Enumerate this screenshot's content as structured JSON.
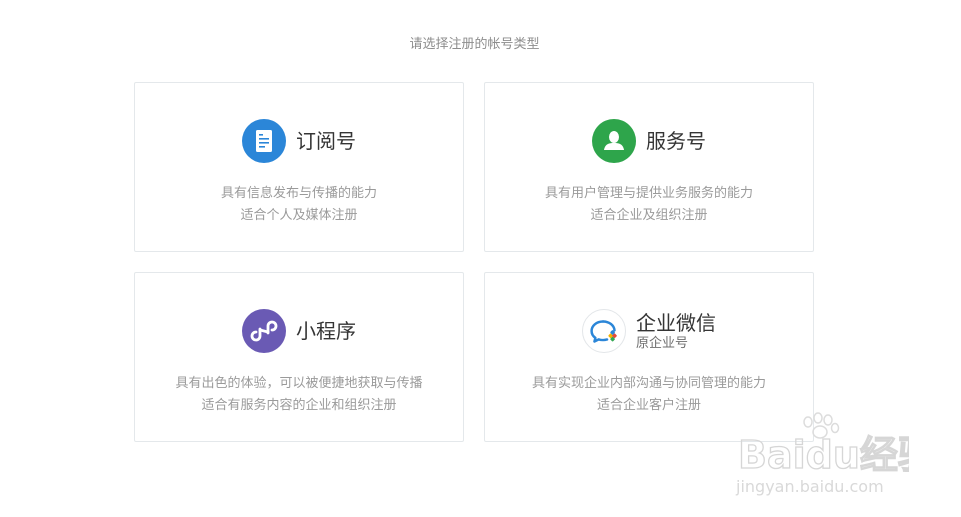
{
  "prompt": "请选择注册的帐号类型",
  "cards": [
    {
      "title": "订阅号",
      "icon": "document-icon",
      "color": "#2b86d8",
      "desc": [
        "具有信息发布与传播的能力",
        "适合个人及媒体注册"
      ]
    },
    {
      "title": "服务号",
      "icon": "person-icon",
      "color": "#2ea54b",
      "desc": [
        "具有用户管理与提供业务服务的能力",
        "适合企业及组织注册"
      ]
    },
    {
      "title": "小程序",
      "icon": "mini-program-icon",
      "color": "#6a5ab4",
      "desc": [
        "具有出色的体验，可以被便捷地获取与传播",
        "适合有服务内容的企业和组织注册"
      ]
    },
    {
      "title": "企业微信",
      "subtitle": "原企业号",
      "icon": "chat-bubble-icon",
      "color": "#2b86d8",
      "desc": [
        "具有实现企业内部沟通与协同管理的能力",
        "适合企业客户注册"
      ]
    }
  ],
  "watermark": {
    "logo_text": "Baidu经验",
    "url": "jingyan.baidu.com"
  }
}
